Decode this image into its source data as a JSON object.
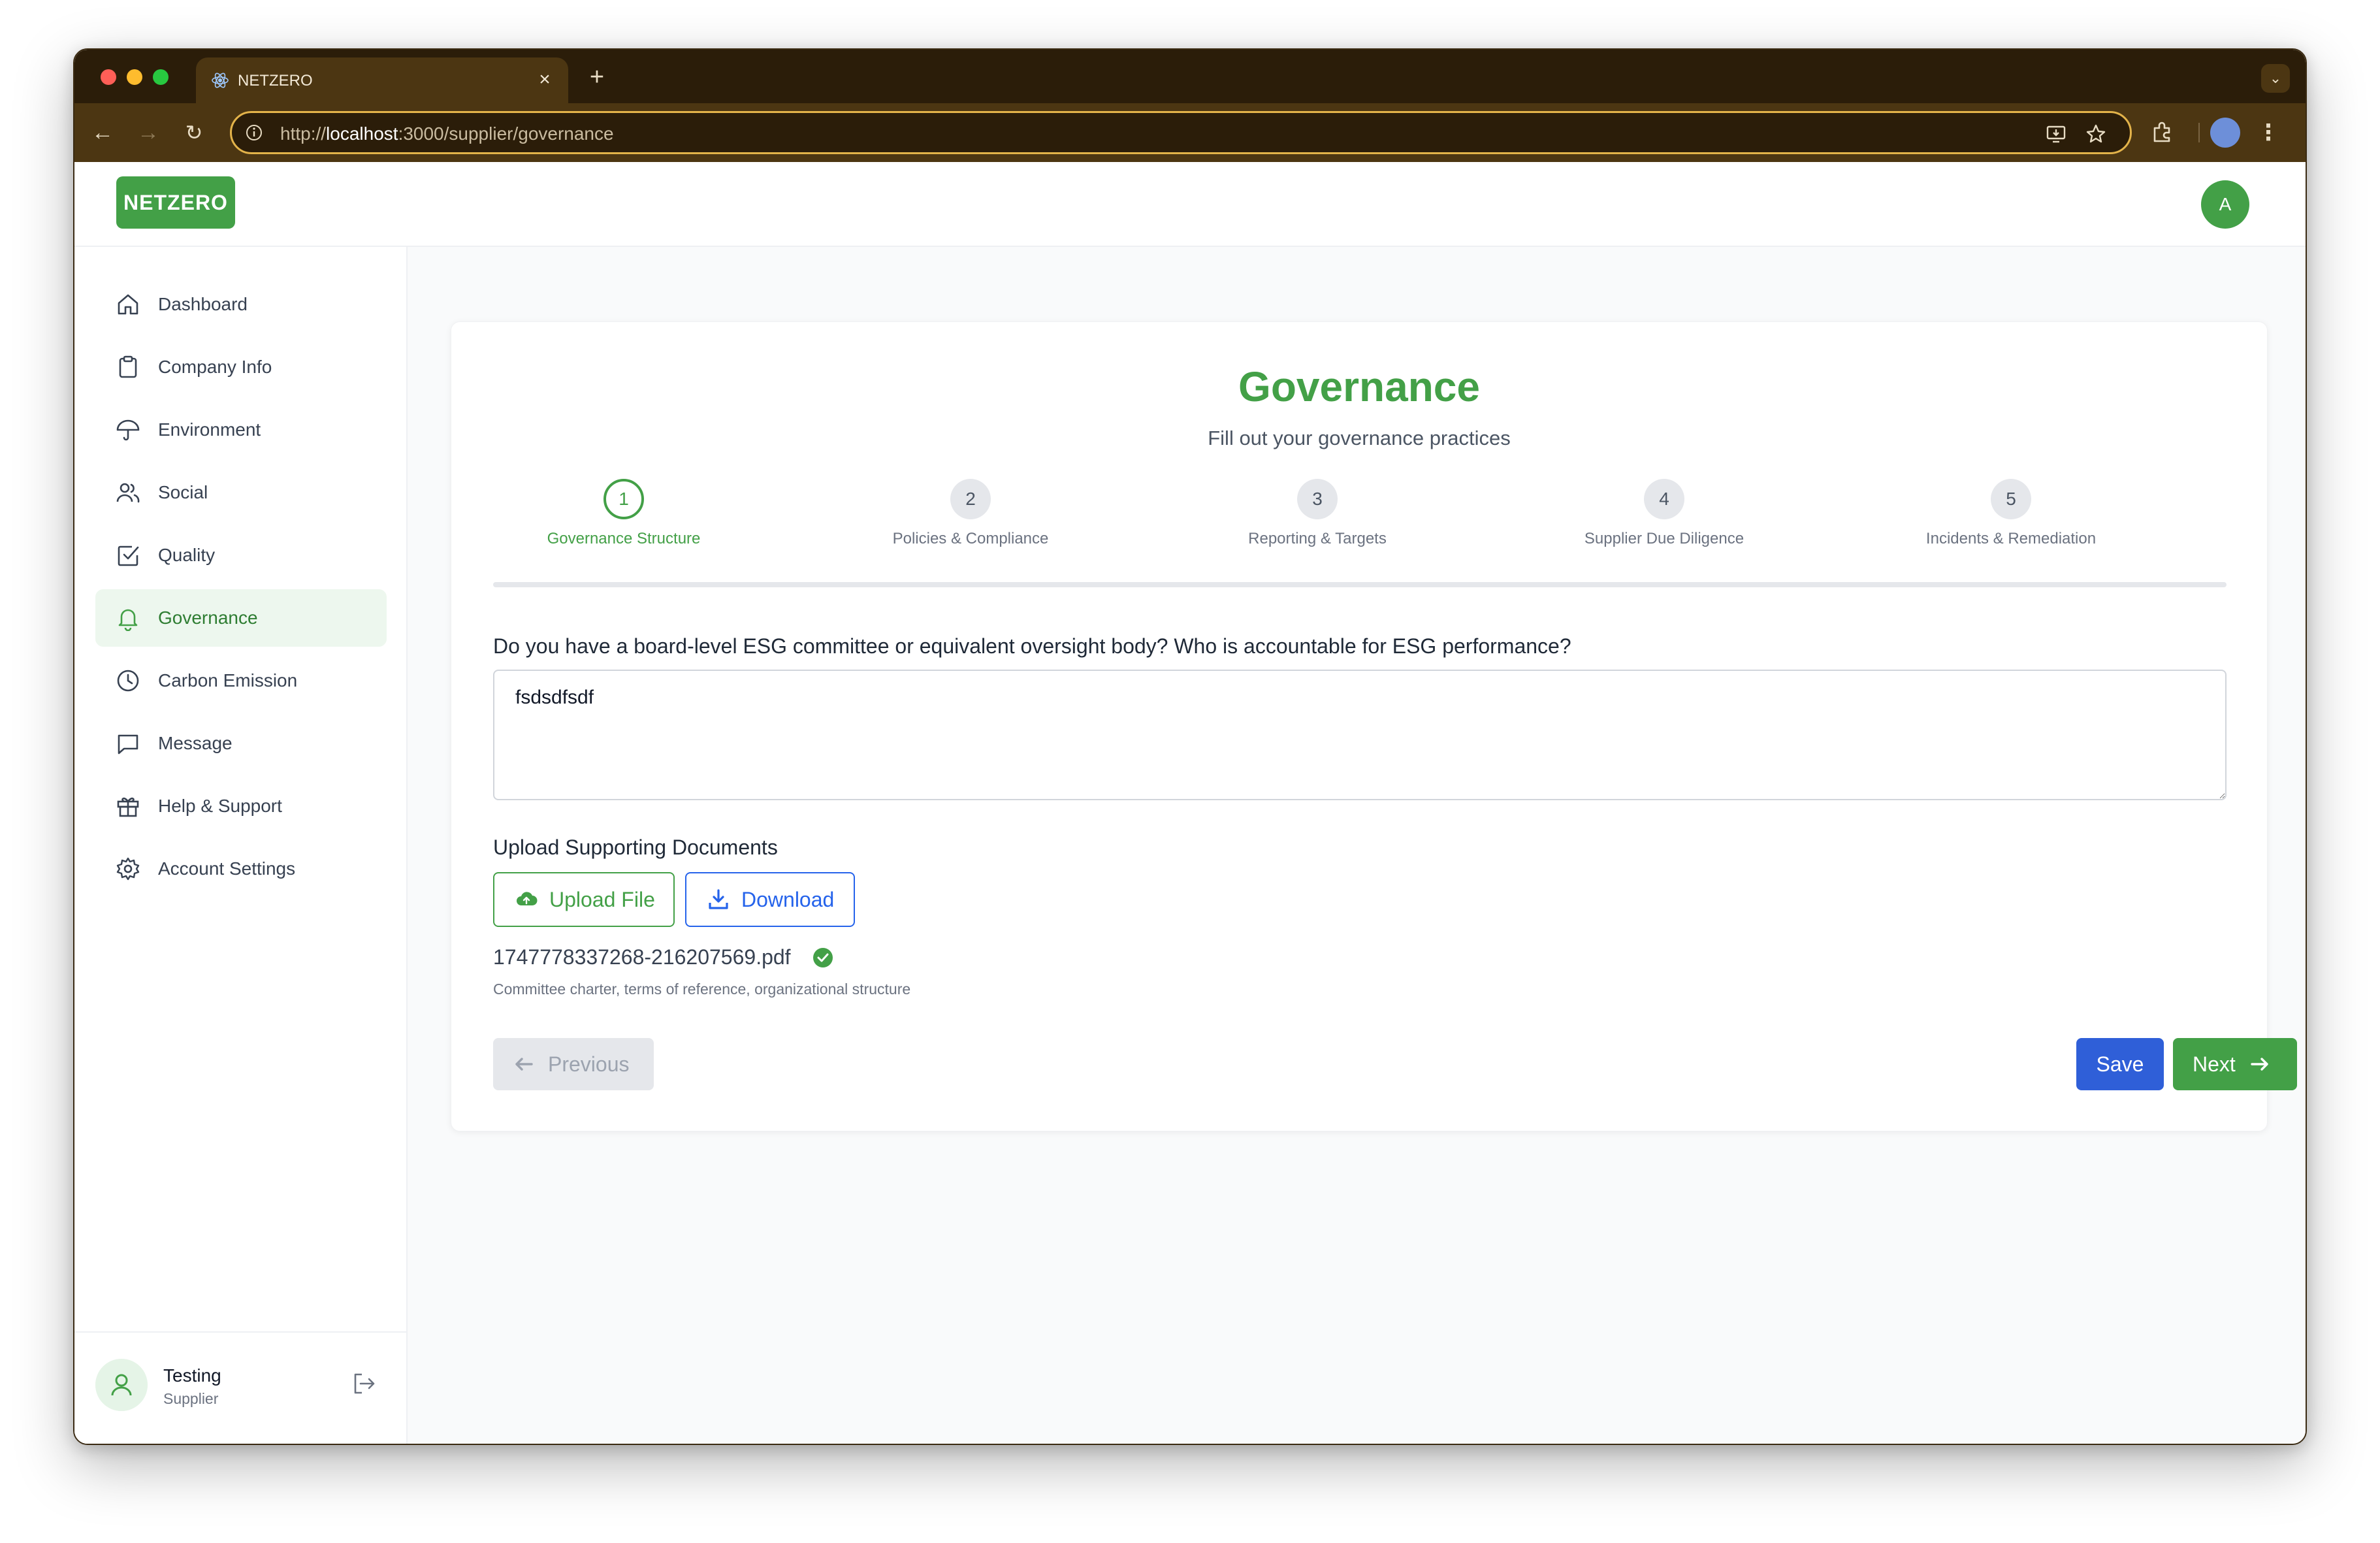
{
  "browser": {
    "tab_title": "NETZERO",
    "url_prefix": "http://",
    "url_host": "localhost",
    "url_path": ":3000/supplier/governance"
  },
  "header": {
    "logo": "NETZERO",
    "avatar_initial": "A"
  },
  "sidebar": {
    "items": [
      {
        "label": "Dashboard",
        "icon": "home-icon"
      },
      {
        "label": "Company Info",
        "icon": "clipboard-icon"
      },
      {
        "label": "Environment",
        "icon": "umbrella-icon"
      },
      {
        "label": "Social",
        "icon": "users-icon"
      },
      {
        "label": "Quality",
        "icon": "check-square-icon"
      },
      {
        "label": "Governance",
        "icon": "bell-icon",
        "active": true
      },
      {
        "label": "Carbon Emission",
        "icon": "clock-icon"
      },
      {
        "label": "Message",
        "icon": "message-icon"
      },
      {
        "label": "Help & Support",
        "icon": "gift-icon"
      },
      {
        "label": "Account Settings",
        "icon": "gear-icon"
      }
    ],
    "user": {
      "name": "Testing",
      "role": "Supplier"
    }
  },
  "form": {
    "title": "Governance",
    "subtitle": "Fill out your governance practices",
    "steps": [
      {
        "number": "1",
        "label": "Governance Structure",
        "active": true
      },
      {
        "number": "2",
        "label": "Policies & Compliance"
      },
      {
        "number": "3",
        "label": "Reporting & Targets"
      },
      {
        "number": "4",
        "label": "Supplier Due Diligence"
      },
      {
        "number": "5",
        "label": "Incidents & Remediation"
      }
    ],
    "question": "Do you have a board-level ESG committee or equivalent oversight body? Who is accountable for ESG performance?",
    "answer": "fsdsdfsdf",
    "upload_heading": "Upload Supporting Documents",
    "upload_label": "Upload File",
    "download_label": "Download",
    "file_name": "1747778337268-216207569.pdf",
    "file_hint": "Committee charter, terms of reference, organizational structure",
    "previous_label": "Previous",
    "save_label": "Save",
    "next_label": "Next"
  },
  "colors": {
    "brand_green": "#43a047",
    "primary_blue": "#2f5fd8",
    "browser_frame": "#4c3612"
  }
}
